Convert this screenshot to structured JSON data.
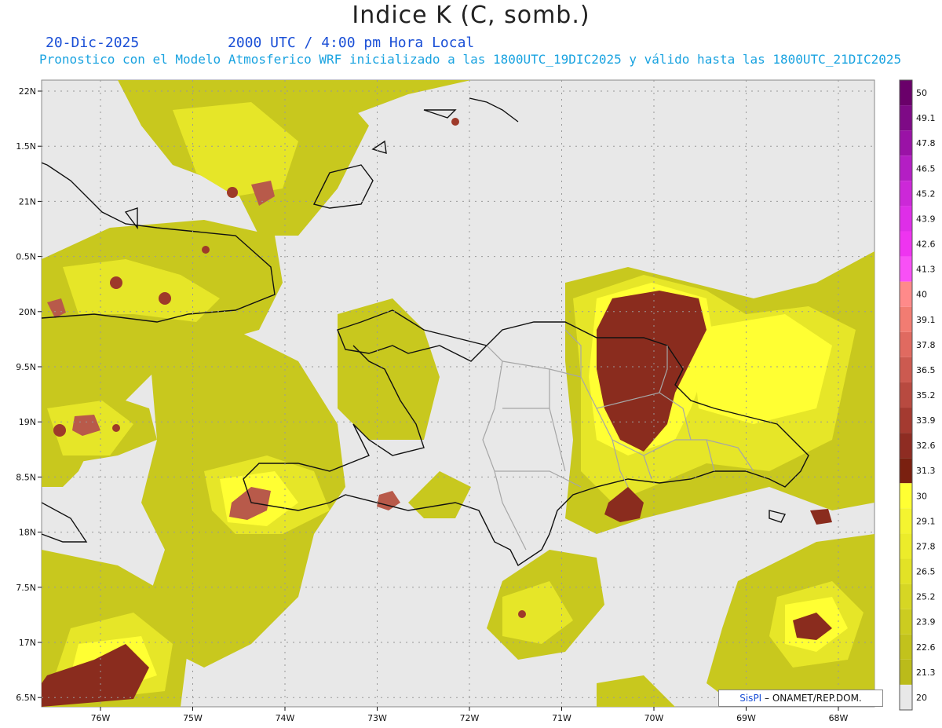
{
  "header": {
    "title": "Indice K (C, somb.)",
    "date": "20-Dic-2025",
    "time": "2000 UTC / 4:00 pm Hora Local",
    "description": "Pronostico con el Modelo Atmosferico WRF inicializado a las 1800UTC_19DIC2025 y válido hasta las  1800UTC_21DIC2025"
  },
  "axes": {
    "lat_labels": [
      "22N",
      "1.5N",
      "21N",
      "0.5N",
      "20N",
      "9.5N",
      "19N",
      "8.5N",
      "18N",
      "7.5N",
      "17N",
      "6.5N"
    ],
    "lon_labels": [
      "76W",
      "75W",
      "74W",
      "73W",
      "72W",
      "71W",
      "70W",
      "69W",
      "68W"
    ]
  },
  "colorbar": {
    "levels": [
      "50",
      "49.1",
      "47.8",
      "46.5",
      "45.2",
      "43.9",
      "42.6",
      "41.3",
      "40",
      "39.1",
      "37.8",
      "36.5",
      "35.2",
      "33.9",
      "32.6",
      "31.3",
      "30",
      "29.1",
      "27.8",
      "26.5",
      "25.2",
      "23.9",
      "22.6",
      "21.3",
      "20"
    ],
    "colors": [
      "#6a006a",
      "#7e0a86",
      "#9a12a6",
      "#b41ec4",
      "#cc28d8",
      "#de2ee8",
      "#ee34f0",
      "#f850f6",
      "#ff8a8a",
      "#f27c72",
      "#e06a60",
      "#cc5a50",
      "#b84a40",
      "#a43a30",
      "#8e2c22",
      "#7a2010",
      "#ffff33",
      "#f4f430",
      "#ecec2a",
      "#e2e226",
      "#d6d624",
      "#cccc20",
      "#c2c21c",
      "#bbbb1a",
      "#e8e8e8"
    ]
  },
  "legend": {
    "credit_brand": "SisPI",
    "credit_text": " – ONAMET/REP.DOM."
  }
}
